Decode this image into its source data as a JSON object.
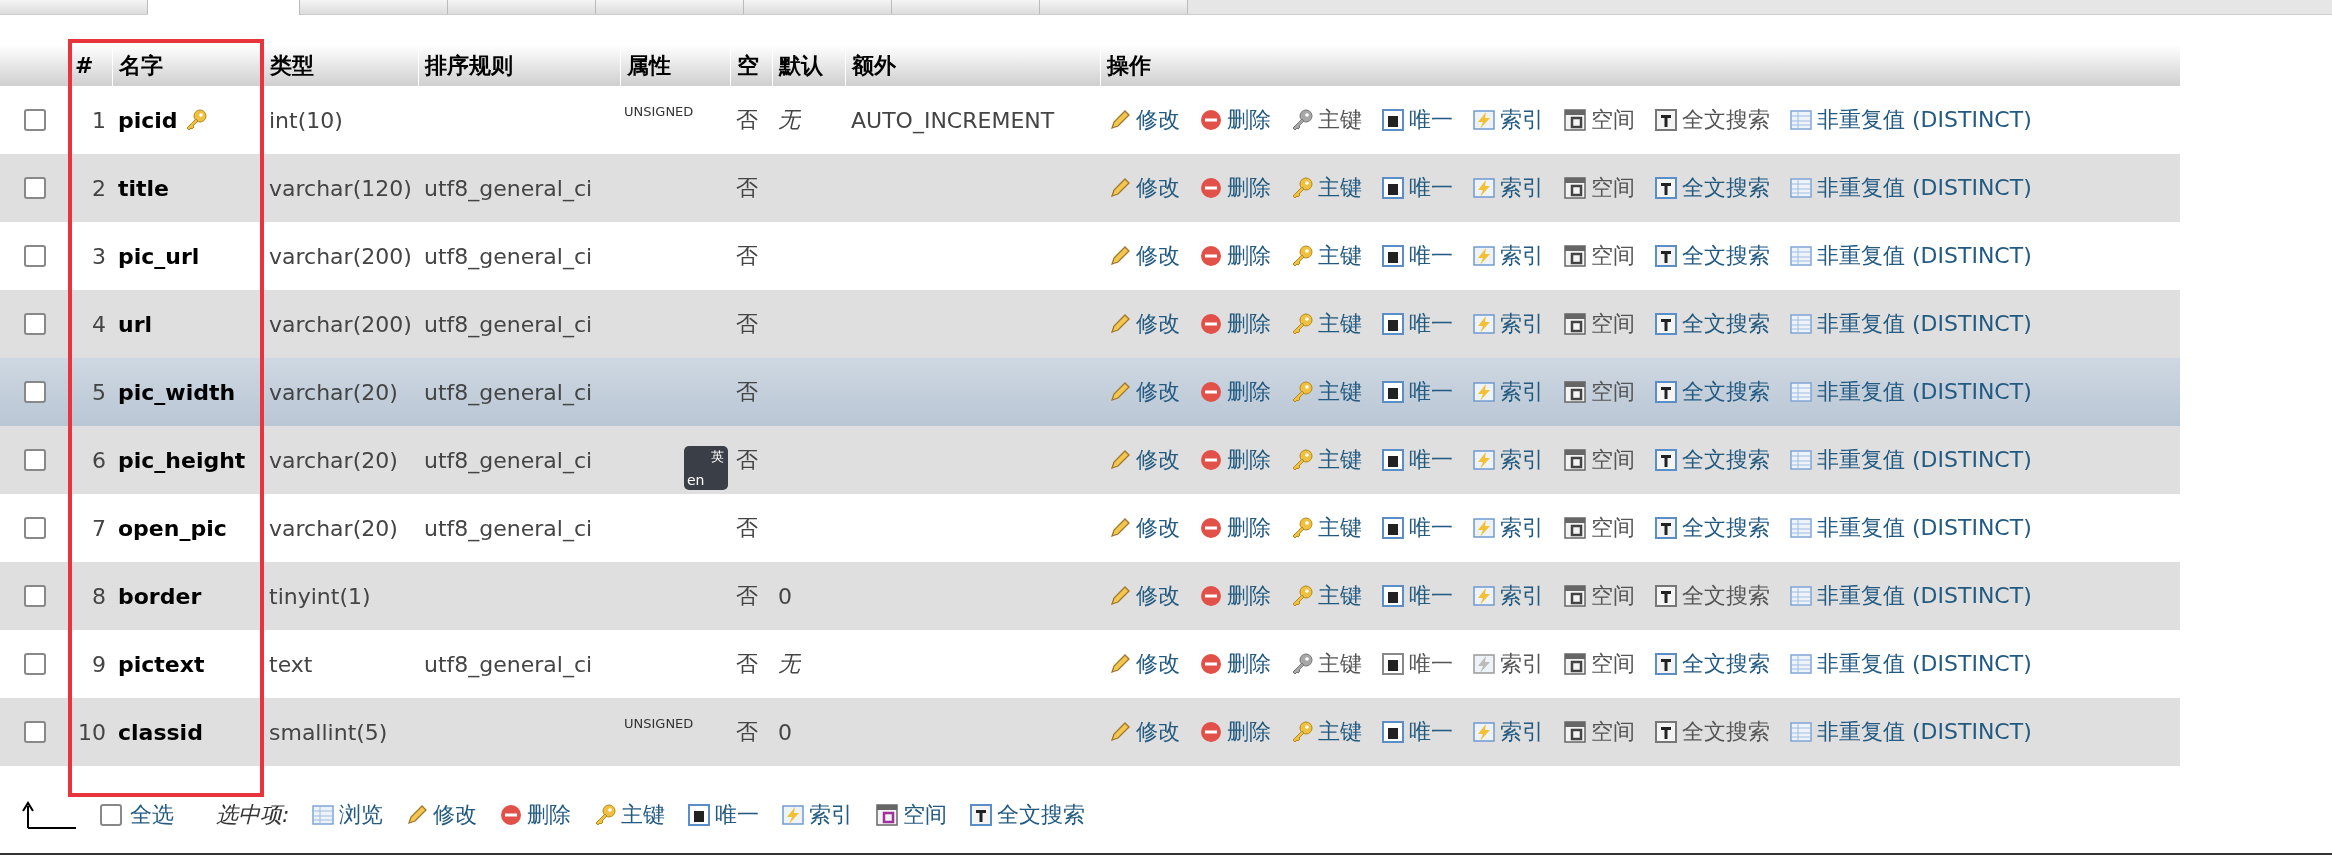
{
  "tabs": [
    {
      "selected": false
    },
    {
      "selected": true
    },
    {
      "selected": false
    },
    {
      "selected": false
    },
    {
      "selected": false
    },
    {
      "selected": false
    },
    {
      "selected": false
    },
    {
      "selected": false
    }
  ],
  "columns": [
    "#",
    "名字",
    "类型",
    "排序规则",
    "属性",
    "空",
    "默认",
    "额外",
    "操作"
  ],
  "rows": [
    {
      "num": "1",
      "name": "picid",
      "primary": true,
      "type": "int(10)",
      "attributes": "UNSIGNED",
      "null": "否",
      "default": "无",
      "default_italic": true,
      "extra": "AUTO_INCREMENT",
      "checked": false,
      "highlighted": false,
      "actions": [
        {
          "kind": "edit",
          "label": "修改",
          "disabled": false
        },
        {
          "kind": "drop",
          "label": "删除",
          "disabled": false
        },
        {
          "kind": "primary",
          "label": "主键",
          "disabled": true
        },
        {
          "kind": "unique",
          "label": "唯一",
          "disabled": false
        },
        {
          "kind": "index",
          "label": "索引",
          "disabled": false
        },
        {
          "kind": "spatial",
          "label": "空间",
          "disabled": true
        },
        {
          "kind": "fulltext",
          "label": "全文搜索",
          "disabled": true
        },
        {
          "kind": "distinct",
          "label": "非重复值 (DISTINCT)",
          "disabled": false
        }
      ]
    },
    {
      "num": "2",
      "name": "title",
      "primary": false,
      "type": "varchar(120)",
      "collation": "utf8_general_ci",
      "null": "否",
      "checked": false,
      "highlighted": false,
      "actions": [
        {
          "kind": "edit",
          "label": "修改",
          "disabled": false
        },
        {
          "kind": "drop",
          "label": "删除",
          "disabled": false
        },
        {
          "kind": "primary",
          "label": "主键",
          "disabled": false
        },
        {
          "kind": "unique",
          "label": "唯一",
          "disabled": false
        },
        {
          "kind": "index",
          "label": "索引",
          "disabled": false
        },
        {
          "kind": "spatial",
          "label": "空间",
          "disabled": true
        },
        {
          "kind": "fulltext",
          "label": "全文搜索",
          "disabled": false
        },
        {
          "kind": "distinct",
          "label": "非重复值 (DISTINCT)",
          "disabled": false
        }
      ]
    },
    {
      "num": "3",
      "name": "pic_url",
      "primary": false,
      "type": "varchar(200)",
      "collation": "utf8_general_ci",
      "null": "否",
      "checked": false,
      "highlighted": false,
      "actions": [
        {
          "kind": "edit",
          "label": "修改",
          "disabled": false
        },
        {
          "kind": "drop",
          "label": "删除",
          "disabled": false
        },
        {
          "kind": "primary",
          "label": "主键",
          "disabled": false
        },
        {
          "kind": "unique",
          "label": "唯一",
          "disabled": false
        },
        {
          "kind": "index",
          "label": "索引",
          "disabled": false
        },
        {
          "kind": "spatial",
          "label": "空间",
          "disabled": true
        },
        {
          "kind": "fulltext",
          "label": "全文搜索",
          "disabled": false
        },
        {
          "kind": "distinct",
          "label": "非重复值 (DISTINCT)",
          "disabled": false
        }
      ]
    },
    {
      "num": "4",
      "name": "url",
      "primary": false,
      "type": "varchar(200)",
      "collation": "utf8_general_ci",
      "null": "否",
      "checked": false,
      "highlighted": false,
      "actions": [
        {
          "kind": "edit",
          "label": "修改",
          "disabled": false
        },
        {
          "kind": "drop",
          "label": "删除",
          "disabled": false
        },
        {
          "kind": "primary",
          "label": "主键",
          "disabled": false
        },
        {
          "kind": "unique",
          "label": "唯一",
          "disabled": false
        },
        {
          "kind": "index",
          "label": "索引",
          "disabled": false
        },
        {
          "kind": "spatial",
          "label": "空间",
          "disabled": true
        },
        {
          "kind": "fulltext",
          "label": "全文搜索",
          "disabled": false
        },
        {
          "kind": "distinct",
          "label": "非重复值 (DISTINCT)",
          "disabled": false
        }
      ]
    },
    {
      "num": "5",
      "name": "pic_width",
      "primary": false,
      "type": "varchar(20)",
      "collation": "utf8_general_ci",
      "null": "否",
      "checked": false,
      "highlighted": true,
      "actions": [
        {
          "kind": "edit",
          "label": "修改",
          "disabled": false
        },
        {
          "kind": "drop",
          "label": "删除",
          "disabled": false
        },
        {
          "kind": "primary",
          "label": "主键",
          "disabled": false
        },
        {
          "kind": "unique",
          "label": "唯一",
          "disabled": false
        },
        {
          "kind": "index",
          "label": "索引",
          "disabled": false
        },
        {
          "kind": "spatial",
          "label": "空间",
          "disabled": true
        },
        {
          "kind": "fulltext",
          "label": "全文搜索",
          "disabled": false
        },
        {
          "kind": "distinct",
          "label": "非重复值 (DISTINCT)",
          "disabled": false
        }
      ]
    },
    {
      "num": "6",
      "name": "pic_height",
      "primary": false,
      "type": "varchar(20)",
      "collation": "utf8_general_ci",
      "null": "否",
      "checked": false,
      "highlighted": false,
      "actions": [
        {
          "kind": "edit",
          "label": "修改",
          "disabled": false
        },
        {
          "kind": "drop",
          "label": "删除",
          "disabled": false
        },
        {
          "kind": "primary",
          "label": "主键",
          "disabled": false
        },
        {
          "kind": "unique",
          "label": "唯一",
          "disabled": false
        },
        {
          "kind": "index",
          "label": "索引",
          "disabled": false
        },
        {
          "kind": "spatial",
          "label": "空间",
          "disabled": true
        },
        {
          "kind": "fulltext",
          "label": "全文搜索",
          "disabled": false
        },
        {
          "kind": "distinct",
          "label": "非重复值 (DISTINCT)",
          "disabled": false
        }
      ]
    },
    {
      "num": "7",
      "name": "open_pic",
      "primary": false,
      "type": "varchar(20)",
      "collation": "utf8_general_ci",
      "null": "否",
      "checked": false,
      "highlighted": false,
      "actions": [
        {
          "kind": "edit",
          "label": "修改",
          "disabled": false
        },
        {
          "kind": "drop",
          "label": "删除",
          "disabled": false
        },
        {
          "kind": "primary",
          "label": "主键",
          "disabled": false
        },
        {
          "kind": "unique",
          "label": "唯一",
          "disabled": false
        },
        {
          "kind": "index",
          "label": "索引",
          "disabled": false
        },
        {
          "kind": "spatial",
          "label": "空间",
          "disabled": true
        },
        {
          "kind": "fulltext",
          "label": "全文搜索",
          "disabled": false
        },
        {
          "kind": "distinct",
          "label": "非重复值 (DISTINCT)",
          "disabled": false
        }
      ]
    },
    {
      "num": "8",
      "name": "border",
      "primary": false,
      "type": "tinyint(1)",
      "null": "否",
      "default": "0",
      "default_italic": false,
      "checked": false,
      "highlighted": false,
      "actions": [
        {
          "kind": "edit",
          "label": "修改",
          "disabled": false
        },
        {
          "kind": "drop",
          "label": "删除",
          "disabled": false
        },
        {
          "kind": "primary",
          "label": "主键",
          "disabled": false
        },
        {
          "kind": "unique",
          "label": "唯一",
          "disabled": false
        },
        {
          "kind": "index",
          "label": "索引",
          "disabled": false
        },
        {
          "kind": "spatial",
          "label": "空间",
          "disabled": true
        },
        {
          "kind": "fulltext",
          "label": "全文搜索",
          "disabled": true
        },
        {
          "kind": "distinct",
          "label": "非重复值 (DISTINCT)",
          "disabled": false
        }
      ]
    },
    {
      "num": "9",
      "name": "pictext",
      "primary": false,
      "type": "text",
      "collation": "utf8_general_ci",
      "null": "否",
      "default": "无",
      "default_italic": true,
      "checked": false,
      "highlighted": false,
      "actions": [
        {
          "kind": "edit",
          "label": "修改",
          "disabled": false
        },
        {
          "kind": "drop",
          "label": "删除",
          "disabled": false
        },
        {
          "kind": "primary",
          "label": "主键",
          "disabled": true
        },
        {
          "kind": "unique",
          "label": "唯一",
          "disabled": true
        },
        {
          "kind": "index",
          "label": "索引",
          "disabled": true
        },
        {
          "kind": "spatial",
          "label": "空间",
          "disabled": true
        },
        {
          "kind": "fulltext",
          "label": "全文搜索",
          "disabled": false
        },
        {
          "kind": "distinct",
          "label": "非重复值 (DISTINCT)",
          "disabled": false
        }
      ]
    },
    {
      "num": "10",
      "name": "classid",
      "primary": false,
      "type": "smallint(5)",
      "attributes": "UNSIGNED",
      "null": "否",
      "default": "0",
      "default_italic": false,
      "checked": false,
      "highlighted": false,
      "actions": [
        {
          "kind": "edit",
          "label": "修改",
          "disabled": false
        },
        {
          "kind": "drop",
          "label": "删除",
          "disabled": false
        },
        {
          "kind": "primary",
          "label": "主键",
          "disabled": false
        },
        {
          "kind": "unique",
          "label": "唯一",
          "disabled": false
        },
        {
          "kind": "index",
          "label": "索引",
          "disabled": false
        },
        {
          "kind": "spatial",
          "label": "空间",
          "disabled": true
        },
        {
          "kind": "fulltext",
          "label": "全文搜索",
          "disabled": true
        },
        {
          "kind": "distinct",
          "label": "非重复值 (DISTINCT)",
          "disabled": false
        }
      ]
    }
  ],
  "footer": {
    "select_all": "全选",
    "checked": false,
    "with_selected": "选中项:",
    "buttons": [
      {
        "kind": "browse",
        "label": "浏览"
      },
      {
        "kind": "edit",
        "label": "修改"
      },
      {
        "kind": "drop",
        "label": "删除"
      },
      {
        "kind": "primary",
        "label": "主键"
      },
      {
        "kind": "unique",
        "label": "唯一"
      },
      {
        "kind": "index",
        "label": "索引"
      },
      {
        "kind": "spatial",
        "label": "空间"
      },
      {
        "kind": "fulltext",
        "label": "全文搜索"
      }
    ]
  },
  "translate_widget": {
    "top": "英",
    "bottom": "en"
  }
}
